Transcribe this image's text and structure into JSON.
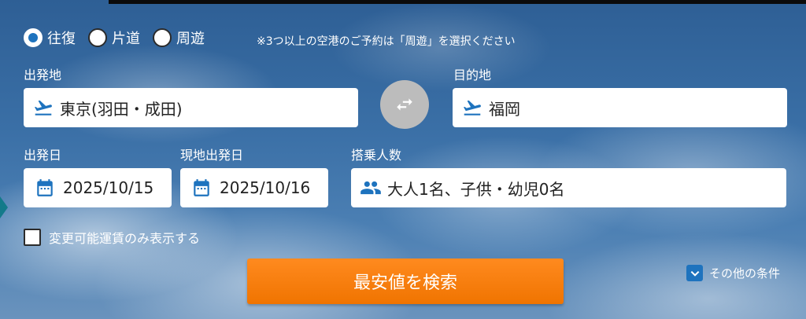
{
  "trip_type": {
    "options": [
      {
        "label": "往復",
        "selected": true
      },
      {
        "label": "片道",
        "selected": false
      },
      {
        "label": "周遊",
        "selected": false
      }
    ],
    "note": "※3つ以上の空港のご予約は「周遊」を選択ください"
  },
  "origin": {
    "label": "出発地",
    "value": "東京(羽田・成田)",
    "icon": "plane-departure-icon"
  },
  "destination": {
    "label": "目的地",
    "value": "福岡",
    "icon": "plane-departure-icon"
  },
  "swap": {
    "icon": "swap-arrows-icon"
  },
  "departure_date": {
    "label": "出発日",
    "value": "2025/10/15",
    "icon": "calendar-icon"
  },
  "return_date": {
    "label": "現地出発日",
    "value": "2025/10/16",
    "icon": "calendar-icon"
  },
  "passengers": {
    "label": "搭乗人数",
    "value": "大人1名、子供・幼児0名",
    "icon": "people-icon"
  },
  "changeable_only": {
    "label": "変更可能運賃のみ表示する",
    "checked": false
  },
  "search_button": {
    "label": "最安値を検索"
  },
  "other_conditions": {
    "label": "その他の条件",
    "icon": "chevron-down-icon"
  },
  "colors": {
    "accent_blue": "#1e73be",
    "search_orange": "#f07400",
    "swap_gray": "#bcbcbc"
  }
}
